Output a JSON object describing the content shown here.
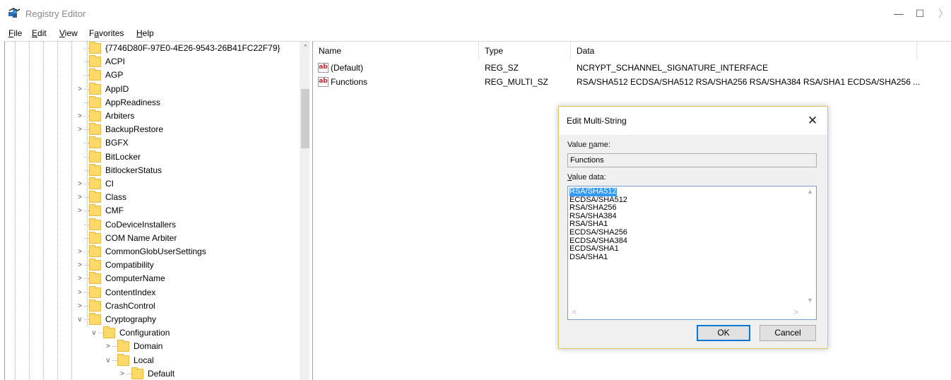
{
  "window": {
    "title": "Registry Editor",
    "min_glyph": "—",
    "max_glyph": "☐",
    "close_glyph": "〉"
  },
  "menu": [
    {
      "u": "F",
      "rest": "ile"
    },
    {
      "u": "E",
      "rest": "dit"
    },
    {
      "u": "V",
      "rest": "iew"
    },
    {
      "pre": "F",
      "u": "a",
      "rest": "vorites"
    },
    {
      "u": "H",
      "rest": "elp"
    }
  ],
  "tree": {
    "items": [
      {
        "label": "{7746D80F-97E0-4E26-9543-26B41FC22F79}",
        "expander": ""
      },
      {
        "label": "ACPI",
        "expander": ""
      },
      {
        "label": "AGP",
        "expander": ""
      },
      {
        "label": "AppID",
        "expander": ">"
      },
      {
        "label": "AppReadiness",
        "expander": ""
      },
      {
        "label": "Arbiters",
        "expander": ">"
      },
      {
        "label": "BackupRestore",
        "expander": ">"
      },
      {
        "label": "BGFX",
        "expander": ""
      },
      {
        "label": "BitLocker",
        "expander": ""
      },
      {
        "label": "BitlockerStatus",
        "expander": ""
      },
      {
        "label": "CI",
        "expander": ">"
      },
      {
        "label": "Class",
        "expander": ">"
      },
      {
        "label": "CMF",
        "expander": ">"
      },
      {
        "label": "CoDeviceInstallers",
        "expander": ""
      },
      {
        "label": "COM Name Arbiter",
        "expander": ""
      },
      {
        "label": "CommonGlobUserSettings",
        "expander": ">"
      },
      {
        "label": "Compatibility",
        "expander": ">"
      },
      {
        "label": "ComputerName",
        "expander": ">"
      },
      {
        "label": "ContentIndex",
        "expander": ">"
      },
      {
        "label": "CrashControl",
        "expander": ">"
      },
      {
        "label": "Cryptography",
        "expander": "v"
      },
      {
        "label": "Configuration",
        "expander": "v"
      },
      {
        "label": "Domain",
        "expander": ">"
      },
      {
        "label": "Local",
        "expander": "v"
      },
      {
        "label": "Default",
        "expander": ">"
      }
    ],
    "scroll_up": "^"
  },
  "values": {
    "headers": {
      "name": "Name",
      "type": "Type",
      "data": "Data"
    },
    "icon_text": "ab",
    "rows": [
      {
        "name": "(Default)",
        "type": "REG_SZ",
        "data": "NCRYPT_SCHANNEL_SIGNATURE_INTERFACE"
      },
      {
        "name": "Functions",
        "type": "REG_MULTI_SZ",
        "data": "RSA/SHA512 ECDSA/SHA512 RSA/SHA256 RSA/SHA384 RSA/SHA1 ECDSA/SHA256 ..."
      }
    ]
  },
  "dialog": {
    "title": "Edit Multi-String",
    "close_glyph": "✕",
    "value_name_label": {
      "pre": "Value ",
      "u": "n",
      "rest": "ame:"
    },
    "value_name": "Functions",
    "value_data_label": {
      "u": "V",
      "rest": "alue data:"
    },
    "value_data": [
      "RSA/SHA512",
      "ECDSA/SHA512",
      "RSA/SHA256",
      "RSA/SHA384",
      "RSA/SHA1",
      "ECDSA/SHA256",
      "ECDSA/SHA384",
      "ECDSA/SHA1",
      "DSA/SHA1"
    ],
    "ok_label": "OK",
    "cancel_label": "Cancel"
  }
}
